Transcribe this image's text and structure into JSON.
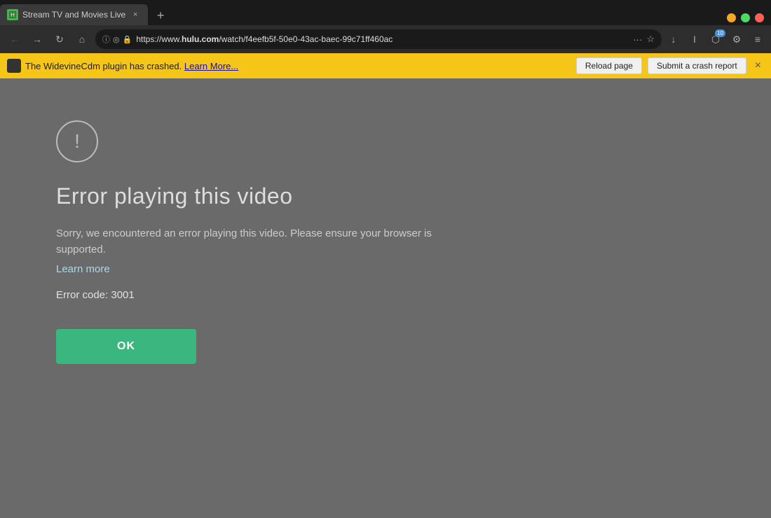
{
  "browser": {
    "tab": {
      "favicon_color": "#4caf50",
      "title": "Stream TV and Movies Live",
      "close_label": "×"
    },
    "new_tab_icon": "+",
    "traffic_lights": {
      "yellow": "#f5a623",
      "green": "#4cd964",
      "red": "#ff5f57"
    },
    "nav": {
      "back_icon": "←",
      "forward_icon": "→",
      "refresh_icon": "↻",
      "home_icon": "⌂"
    },
    "address_bar": {
      "info_icon": "ⓘ",
      "shield_icon": "◎",
      "lock_icon": "🔒",
      "url_prefix": "https://www.",
      "url_domain": "hulu.com",
      "url_path": "/watch/f4eefb5f-50e0-43ac-baec-99c71ff460ac",
      "more_icon": "···",
      "star_icon": "☆"
    },
    "toolbar": {
      "download_icon": "↓",
      "reader_icon": "I",
      "extensions_icon": "⬡",
      "extensions_badge": "10",
      "settings_icon": "⚙",
      "menu_icon": "≡"
    }
  },
  "notification_bar": {
    "message": "The WidevineCdm plugin has crashed.",
    "learn_more_text": "Learn More...",
    "reload_button": "Reload page",
    "crash_report_button": "Submit a crash report",
    "close_icon": "×"
  },
  "page": {
    "error_title": "Error playing this video",
    "error_description": "Sorry, we encountered an error playing this video. Please ensure your browser is supported.",
    "learn_more_link": "Learn more",
    "error_code_label": "Error code:",
    "error_code_value": "3001",
    "ok_button": "OK"
  }
}
